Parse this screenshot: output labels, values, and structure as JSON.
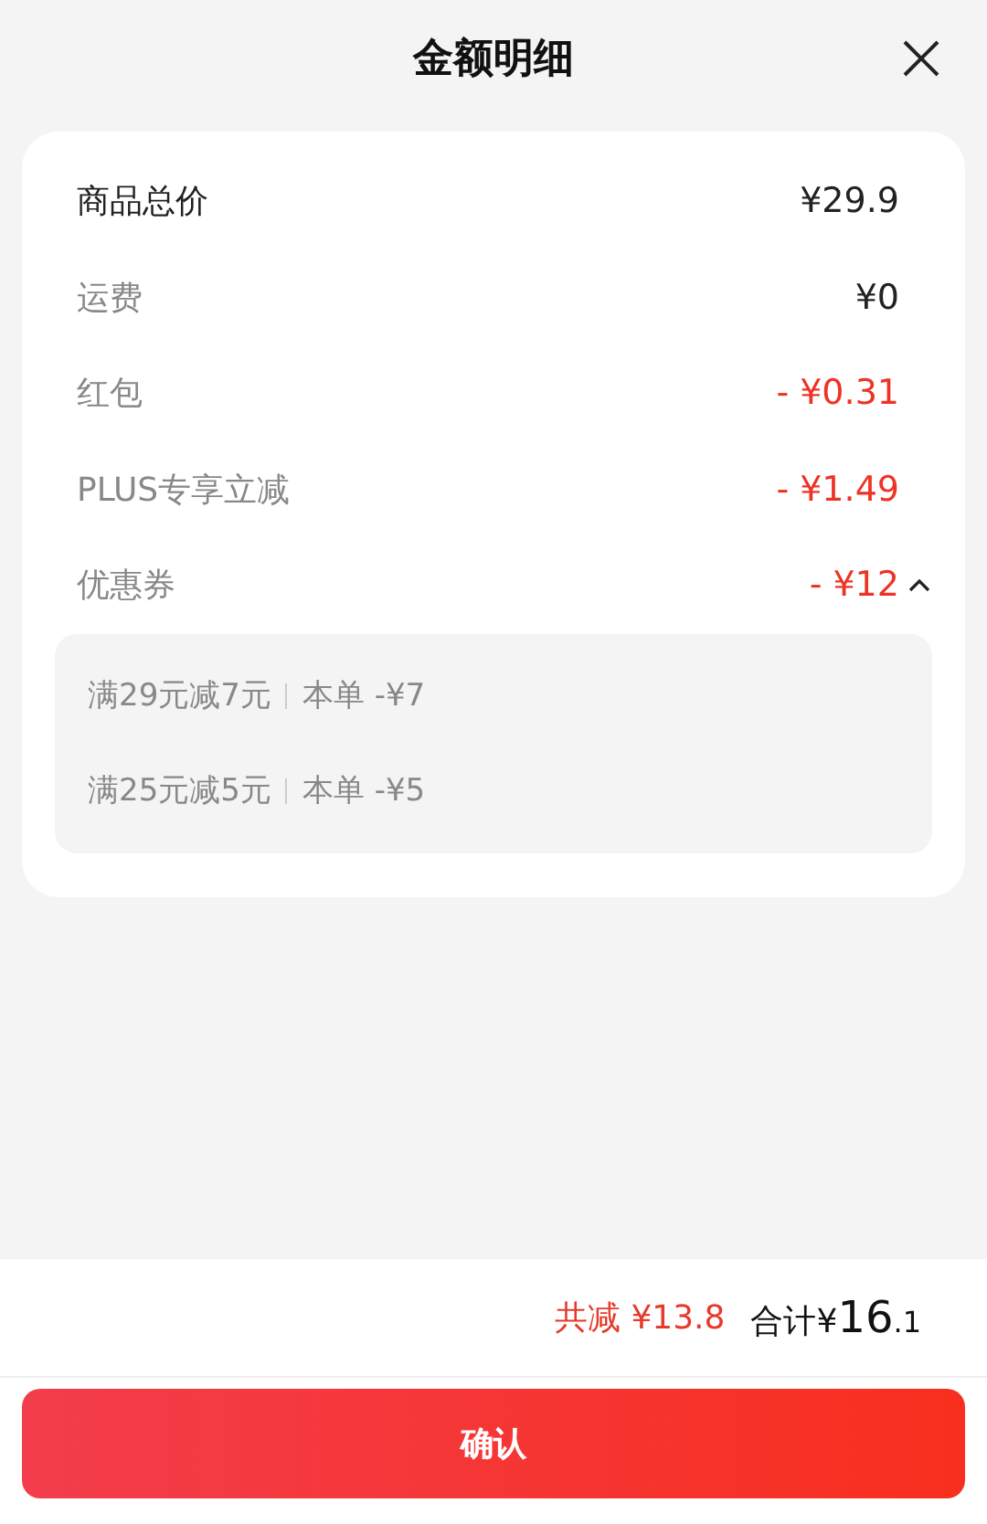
{
  "title": "金额明细",
  "rows": [
    {
      "label": "商品总价",
      "value": "¥29.9",
      "kind": "price"
    },
    {
      "label": "运费",
      "value": "¥0",
      "kind": "fee"
    },
    {
      "label": "红包",
      "value": "- ¥0.31",
      "kind": "discount"
    },
    {
      "label": "PLUS专享立减",
      "value": "- ¥1.49",
      "kind": "discount"
    },
    {
      "label": "优惠券",
      "value": "- ¥12",
      "kind": "discount",
      "expanded": true,
      "coupons": [
        {
          "rule": "满29元减7元",
          "saving": "本单 -¥7"
        },
        {
          "rule": "满25元减5元",
          "saving": "本单 -¥5"
        }
      ]
    }
  ],
  "summary": {
    "saved": "共减 ¥13.8",
    "total_label": "合计",
    "currency": "¥",
    "integer": "16",
    "decimal": ".1"
  },
  "confirm_button": "确认"
}
